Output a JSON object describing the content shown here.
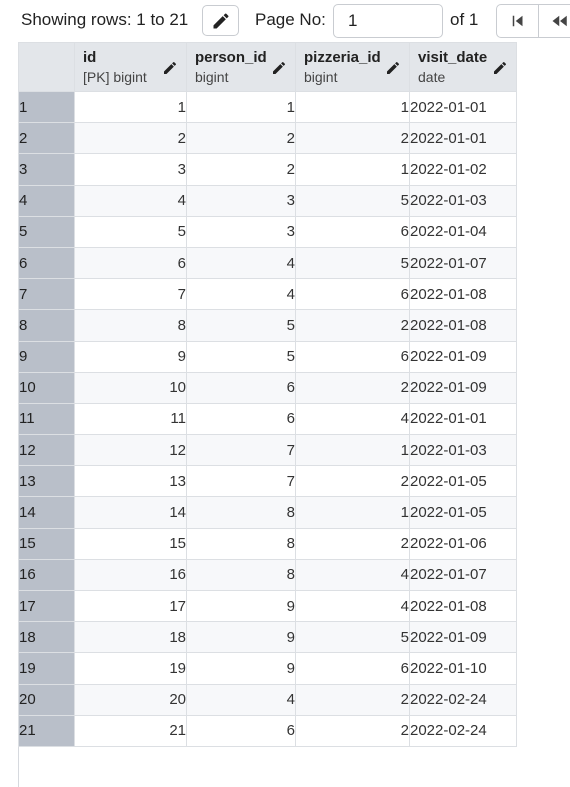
{
  "toolbar": {
    "rows_label": "Showing rows: 1 to 21",
    "page_label": "Page No:",
    "page_value": "1",
    "of_label": "of 1"
  },
  "columns": [
    {
      "name": "id",
      "type": "[PK] bigint"
    },
    {
      "name": "person_id",
      "type": "bigint"
    },
    {
      "name": "pizzeria_id",
      "type": "bigint"
    },
    {
      "name": "visit_date",
      "type": "date"
    }
  ],
  "rows": [
    {
      "rownum": "1",
      "id": "1",
      "person_id": "1",
      "pizzeria_id": "1",
      "visit_date": "2022-01-01"
    },
    {
      "rownum": "2",
      "id": "2",
      "person_id": "2",
      "pizzeria_id": "2",
      "visit_date": "2022-01-01"
    },
    {
      "rownum": "3",
      "id": "3",
      "person_id": "2",
      "pizzeria_id": "1",
      "visit_date": "2022-01-02"
    },
    {
      "rownum": "4",
      "id": "4",
      "person_id": "3",
      "pizzeria_id": "5",
      "visit_date": "2022-01-03"
    },
    {
      "rownum": "5",
      "id": "5",
      "person_id": "3",
      "pizzeria_id": "6",
      "visit_date": "2022-01-04"
    },
    {
      "rownum": "6",
      "id": "6",
      "person_id": "4",
      "pizzeria_id": "5",
      "visit_date": "2022-01-07"
    },
    {
      "rownum": "7",
      "id": "7",
      "person_id": "4",
      "pizzeria_id": "6",
      "visit_date": "2022-01-08"
    },
    {
      "rownum": "8",
      "id": "8",
      "person_id": "5",
      "pizzeria_id": "2",
      "visit_date": "2022-01-08"
    },
    {
      "rownum": "9",
      "id": "9",
      "person_id": "5",
      "pizzeria_id": "6",
      "visit_date": "2022-01-09"
    },
    {
      "rownum": "10",
      "id": "10",
      "person_id": "6",
      "pizzeria_id": "2",
      "visit_date": "2022-01-09"
    },
    {
      "rownum": "11",
      "id": "11",
      "person_id": "6",
      "pizzeria_id": "4",
      "visit_date": "2022-01-01"
    },
    {
      "rownum": "12",
      "id": "12",
      "person_id": "7",
      "pizzeria_id": "1",
      "visit_date": "2022-01-03"
    },
    {
      "rownum": "13",
      "id": "13",
      "person_id": "7",
      "pizzeria_id": "2",
      "visit_date": "2022-01-05"
    },
    {
      "rownum": "14",
      "id": "14",
      "person_id": "8",
      "pizzeria_id": "1",
      "visit_date": "2022-01-05"
    },
    {
      "rownum": "15",
      "id": "15",
      "person_id": "8",
      "pizzeria_id": "2",
      "visit_date": "2022-01-06"
    },
    {
      "rownum": "16",
      "id": "16",
      "person_id": "8",
      "pizzeria_id": "4",
      "visit_date": "2022-01-07"
    },
    {
      "rownum": "17",
      "id": "17",
      "person_id": "9",
      "pizzeria_id": "4",
      "visit_date": "2022-01-08"
    },
    {
      "rownum": "18",
      "id": "18",
      "person_id": "9",
      "pizzeria_id": "5",
      "visit_date": "2022-01-09"
    },
    {
      "rownum": "19",
      "id": "19",
      "person_id": "9",
      "pizzeria_id": "6",
      "visit_date": "2022-01-10"
    },
    {
      "rownum": "20",
      "id": "20",
      "person_id": "4",
      "pizzeria_id": "2",
      "visit_date": "2022-02-24"
    },
    {
      "rownum": "21",
      "id": "21",
      "person_id": "6",
      "pizzeria_id": "2",
      "visit_date": "2022-02-24"
    }
  ],
  "icons": {
    "edit": "pencil-icon",
    "first_page": "first-page-icon",
    "prev_page": "previous-page-icon"
  }
}
